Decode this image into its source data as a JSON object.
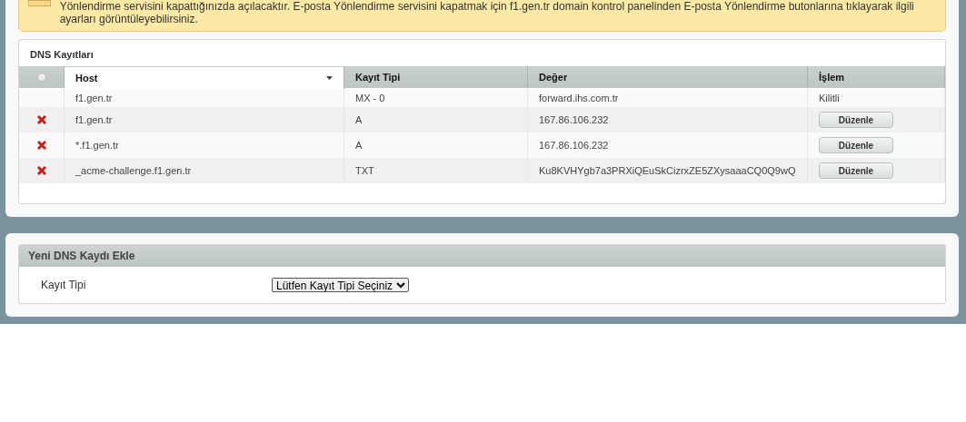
{
  "notice": {
    "text": "Yönlendirme servisini kapattığınızda açılacaktır. E-posta Yönlendirme servisini kapatmak için f1.gen.tr domain kontrol panelinden E-posta Yönlendirme butonlarına tıklayarak ilgili ayarları görüntüleyebilirsiniz."
  },
  "dns_records": {
    "title": "DNS Kayıtları",
    "select_all": {
      "checked": false
    },
    "columns": [
      {
        "label": "Host",
        "sortable": true
      },
      {
        "label": "Kayıt Tipi",
        "sortable": false
      },
      {
        "label": "Değer",
        "sortable": false
      },
      {
        "label": "İşlem",
        "sortable": false
      }
    ],
    "rows": [
      {
        "deletable": false,
        "host": "f1.gen.tr",
        "type": "MX - 0",
        "value": "forward.ihs.com.tr",
        "action": {
          "kind": "text",
          "label": "Kilitli"
        }
      },
      {
        "deletable": true,
        "host": "f1.gen.tr",
        "type": "A",
        "value": "167.86.106.232",
        "action": {
          "kind": "button",
          "label": "Düzenle"
        }
      },
      {
        "deletable": true,
        "host": "*.f1.gen.tr",
        "type": "A",
        "value": "167.86.106.232",
        "action": {
          "kind": "button",
          "label": "Düzenle"
        }
      },
      {
        "deletable": true,
        "host": "_acme-challenge.f1.gen.tr",
        "type": "TXT",
        "value": "Ku8KVHYgb7a3PRXiQEuSkCizrxZE5ZXysaaaCQ0Q9wQ",
        "action": {
          "kind": "button",
          "label": "Düzenle"
        }
      }
    ]
  },
  "new_record": {
    "title": "Yeni DNS Kaydı Ekle",
    "field_label": "Kayıt Tipi",
    "select_value": "Lütfen Kayıt Tipi Seçiniz"
  }
}
